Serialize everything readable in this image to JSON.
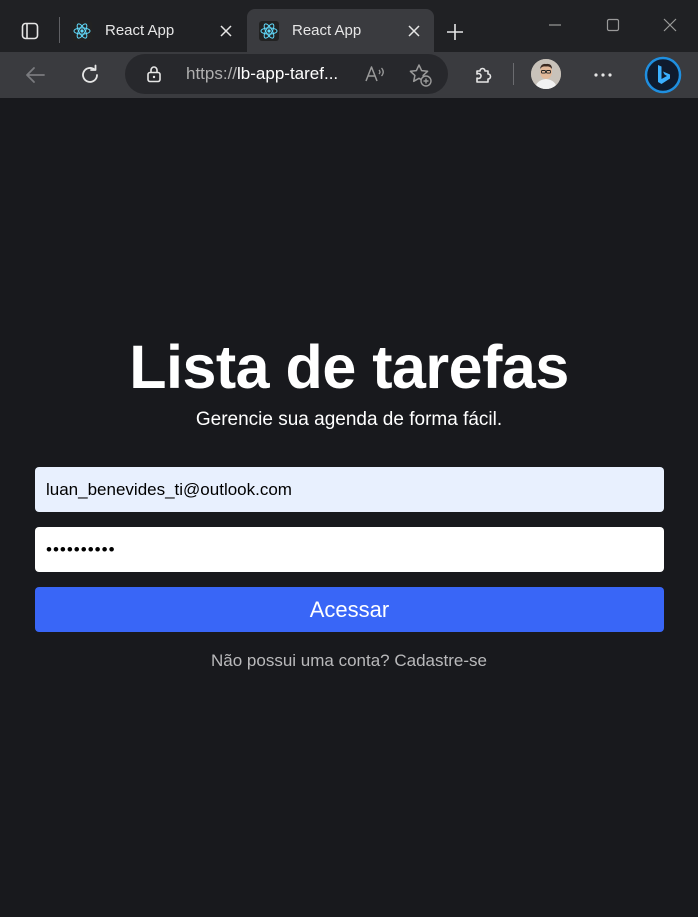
{
  "browser": {
    "tabs": [
      {
        "title": "React App",
        "active": false
      },
      {
        "title": "React App",
        "active": true
      }
    ],
    "address": {
      "scheme": "https://",
      "host": "lb-app-taref..."
    }
  },
  "colors": {
    "page_bg": "#18191d",
    "primary_button": "#3966f7",
    "email_bg": "#e8f0fe",
    "react_icon": "#61dafb",
    "bing_icon": "#1f8fe0"
  },
  "icons": {
    "tab_favicon": "react-logo-icon",
    "tab_close": "close-icon",
    "lock": "lock-icon",
    "back": "back-arrow-icon",
    "refresh": "refresh-icon",
    "read_aloud": "read-aloud-icon",
    "favorites": "add-favorite-icon",
    "extensions": "puzzle-icon",
    "more": "more-dots-icon",
    "copilot": "bing-copilot-icon"
  },
  "login": {
    "title": "Lista de tarefas",
    "subtitle": "Gerencie sua agenda de forma fácil.",
    "email_value": "luan_benevides_ti@outlook.com",
    "password_value": "••••••••••",
    "submit_label": "Acessar",
    "signup_prompt": "Não possui uma conta?",
    "signup_link": "Cadastre-se"
  }
}
